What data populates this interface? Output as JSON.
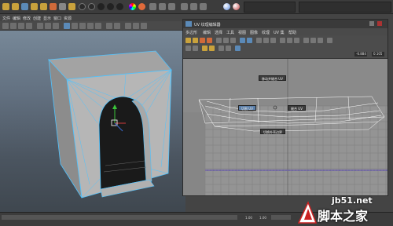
{
  "menubar": {
    "items": [
      "文件",
      "编辑",
      "修改",
      "创建",
      "显示",
      "窗口",
      "资源"
    ]
  },
  "uv_editor": {
    "title": "UV 纹理编辑器",
    "menu": [
      "多边形",
      "编辑",
      "选择",
      "工具",
      "视图",
      "图像",
      "纹理",
      "UV 集",
      "帮助"
    ],
    "field_left": "-6.884",
    "field_right": "0.105",
    "marking_menu": {
      "top": "移动并缝合 UV",
      "left": "切割 UV",
      "right": "缝合 UV",
      "bottom": "切换外壳边界"
    }
  },
  "timeline": {
    "start": "1.00",
    "end": "1.00"
  },
  "watermark": {
    "site": "jb51.net",
    "name": "脚本之家"
  },
  "colors": {
    "selection": "#4fc3ff",
    "menu_active": "#5a7ea8",
    "uv_grid": "#868686"
  }
}
